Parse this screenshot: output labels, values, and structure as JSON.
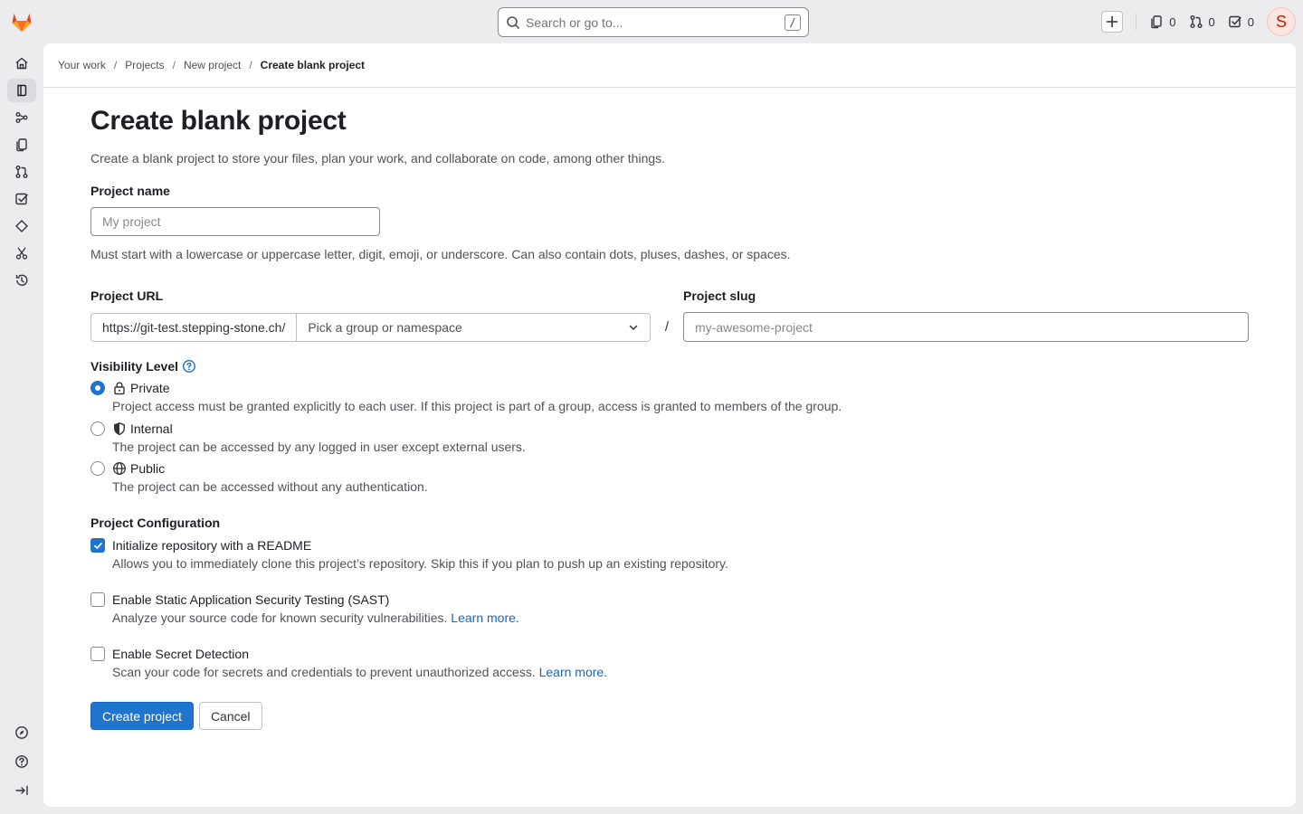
{
  "search": {
    "placeholder": "Search or go to...",
    "shortcut": "/"
  },
  "top_counters": {
    "issues": "0",
    "merge_requests": "0",
    "todos": "0"
  },
  "user": {
    "avatar_letter": "S"
  },
  "breadcrumb": [
    "Your work",
    "Projects",
    "New project",
    "Create blank project"
  ],
  "page": {
    "title": "Create blank project",
    "description": "Create a blank project to store your files, plan your work, and collaborate on code, among other things."
  },
  "project_name": {
    "label": "Project name",
    "placeholder": "My project",
    "help": "Must start with a lowercase or uppercase letter, digit, emoji, or underscore. Can also contain dots, pluses, dashes, or spaces."
  },
  "project_url": {
    "label": "Project URL",
    "prefix": "https://git-test.stepping-stone.ch/",
    "namespace_placeholder": "Pick a group or namespace",
    "separator": "/"
  },
  "project_slug": {
    "label": "Project slug",
    "placeholder": "my-awesome-project"
  },
  "visibility": {
    "label": "Visibility Level",
    "options": [
      {
        "label": "Private",
        "help": "Project access must be granted explicitly to each user. If this project is part of a group, access is granted to members of the group.",
        "selected": true
      },
      {
        "label": "Internal",
        "help": "The project can be accessed by any logged in user except external users.",
        "selected": false
      },
      {
        "label": "Public",
        "help": "The project can be accessed without any authentication.",
        "selected": false
      }
    ]
  },
  "configuration": {
    "label": "Project Configuration",
    "options": [
      {
        "label": "Initialize repository with a README",
        "help": "Allows you to immediately clone this project’s repository. Skip this if you plan to push up an existing repository.",
        "checked": true
      },
      {
        "label": "Enable Static Application Security Testing (SAST)",
        "help": "Analyze your source code for known security vulnerabilities.",
        "link": "Learn more.",
        "checked": false
      },
      {
        "label": "Enable Secret Detection",
        "help": "Scan your code for secrets and credentials to prevent unauthorized access.",
        "link": "Learn more.",
        "checked": false
      }
    ]
  },
  "buttons": {
    "create": "Create project",
    "cancel": "Cancel"
  },
  "colors": {
    "primary": "#1f75cb",
    "link": "#1068bf",
    "background": "#ececef",
    "logo": "#fc6d26"
  }
}
